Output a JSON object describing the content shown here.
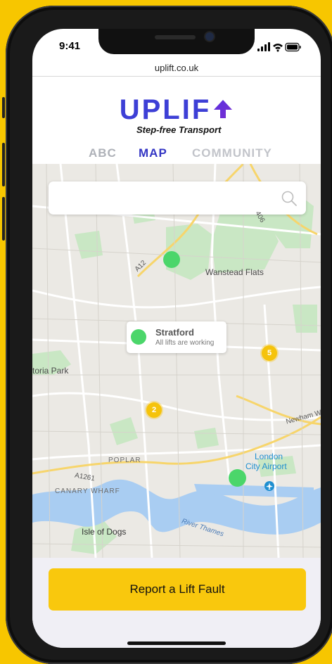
{
  "status": {
    "time": "9:41"
  },
  "browser": {
    "url": "uplift.co.uk"
  },
  "app": {
    "logo_text": "UPLIF",
    "tagline": "Step-free Transport",
    "brand_color": "#3d3fd6",
    "accent_color": "#F9C80D"
  },
  "tabs": [
    {
      "label": "ABC",
      "active": false
    },
    {
      "label": "MAP",
      "active": true
    },
    {
      "label": "COMMUNITY",
      "active": false
    }
  ],
  "search": {
    "placeholder": "",
    "value": "",
    "icon": "search-icon"
  },
  "map": {
    "labels": {
      "wanstead": "Wanstead Flats",
      "victoria_park": "toria Park",
      "poplar": "POPLAR",
      "canary_wharf": "CANARY WHARF",
      "isle_of_dogs": "Isle of Dogs",
      "river_thames": "River Thames",
      "airport_1": "London",
      "airport_2": "City Airport",
      "a12": "A12",
      "a1261": "A1261",
      "newham": "Newham W",
      "a406": "406"
    },
    "callout": {
      "title": "Stratford",
      "status": "All lifts are working"
    },
    "clusters": [
      {
        "count": "5"
      },
      {
        "count": "2"
      }
    ],
    "pin_status_color": "#4bd66a",
    "cluster_color": "#f5c30b"
  },
  "report_button": {
    "label": "Report a Lift Fault"
  }
}
